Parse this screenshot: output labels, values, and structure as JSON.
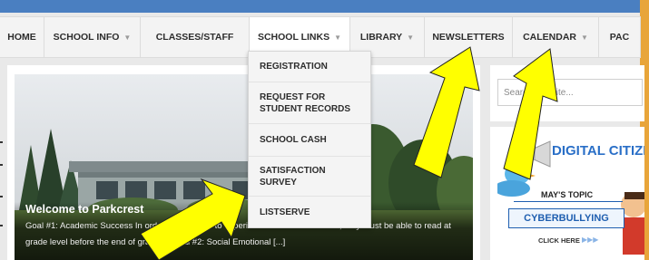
{
  "nav": {
    "items": [
      {
        "label": "HOME",
        "has_caret": false
      },
      {
        "label": "SCHOOL INFO",
        "has_caret": true
      },
      {
        "label": "CLASSES/STAFF",
        "has_caret": false
      },
      {
        "label": "SCHOOL LINKS",
        "has_caret": true,
        "active": true
      },
      {
        "label": "LIBRARY",
        "has_caret": true
      },
      {
        "label": "NEWSLETTERS",
        "has_caret": false
      },
      {
        "label": "CALENDAR",
        "has_caret": true
      },
      {
        "label": "PAC",
        "has_caret": false
      }
    ],
    "caret": "▼"
  },
  "dropdown": {
    "items": [
      "REGISTRATION",
      "REQUEST FOR STUDENT RECORDS",
      "SCHOOL CASH",
      "SATISFACTION SURVEY",
      "LISTSERVE"
    ]
  },
  "hero": {
    "title": "Welcome to Parkcrest",
    "excerpt": "Goal #1: Academic Success In order for students to experience academic success, they must be able to read at grade level before the end of grade 3. Goal #2: Social Emotional [...]"
  },
  "sidebar": {
    "search_placeholder": "Search this site...",
    "promo": {
      "title": "DIGITAL CITIZE",
      "topic_label": "MAY'S TOPIC",
      "topic": "CYBERBULLYING",
      "cta": "CLICK HERE",
      "cta_arrows": "▶▶▶"
    }
  },
  "colors": {
    "header_band": "#4a7fc1",
    "annotation_arrow": "#ffff00"
  }
}
